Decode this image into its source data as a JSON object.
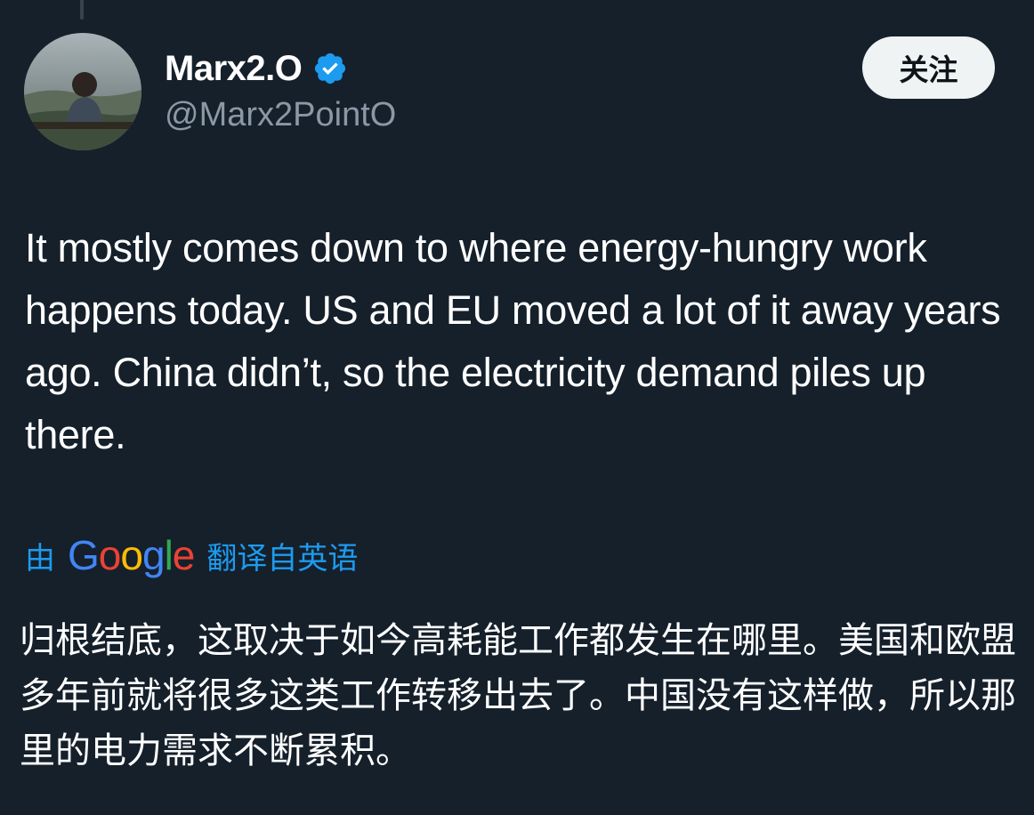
{
  "author": {
    "display_name": "Marx2.O",
    "handle": "@Marx2PointO"
  },
  "follow_button": {
    "label": "关注"
  },
  "tweet": {
    "text": "It mostly comes down to where energy-hungry work happens today. US and EU moved a lot of it away years ago. China didn’t, so the electricity demand piles up there."
  },
  "translation": {
    "prefix": "由",
    "provider_letters": [
      {
        "char": "G",
        "color": "#4285f4"
      },
      {
        "char": "o",
        "color": "#ea4335"
      },
      {
        "char": "o",
        "color": "#fbbc05"
      },
      {
        "char": "g",
        "color": "#4285f4"
      },
      {
        "char": "l",
        "color": "#34a853"
      },
      {
        "char": "e",
        "color": "#ea4335"
      }
    ],
    "suffix": "翻译自英语",
    "text": "归根结底，这取决于如今高耗能工作都发生在哪里。美国和欧盟多年前就将很多这类工作转移出去了。中国没有这样做，所以那里的电力需求不断累积。"
  },
  "colors": {
    "background": "#15202b",
    "link": "#1d9bf0",
    "secondary_text": "#8b98a5",
    "verified_badge": "#1d9bf0"
  },
  "icons": {
    "verified": "verified-badge-icon",
    "avatar": "profile-avatar"
  }
}
